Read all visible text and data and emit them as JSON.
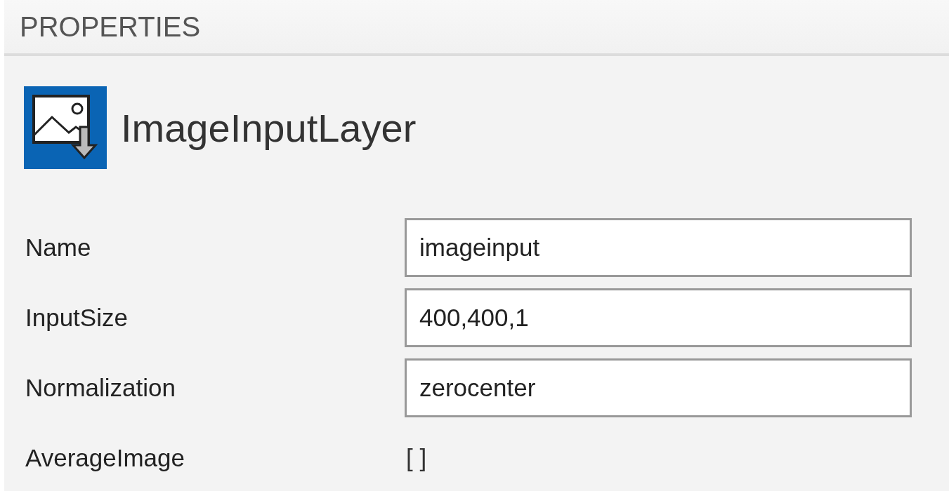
{
  "panel": {
    "title": "PROPERTIES"
  },
  "layer": {
    "name": "ImageInputLayer"
  },
  "properties": [
    {
      "label": "Name",
      "kind": "field",
      "value": "imageinput"
    },
    {
      "label": "InputSize",
      "kind": "field",
      "value": "400,400,1"
    },
    {
      "label": "Normalization",
      "kind": "field",
      "value": "zerocenter"
    },
    {
      "label": "AverageImage",
      "kind": "static",
      "value": "[ ]"
    }
  ]
}
